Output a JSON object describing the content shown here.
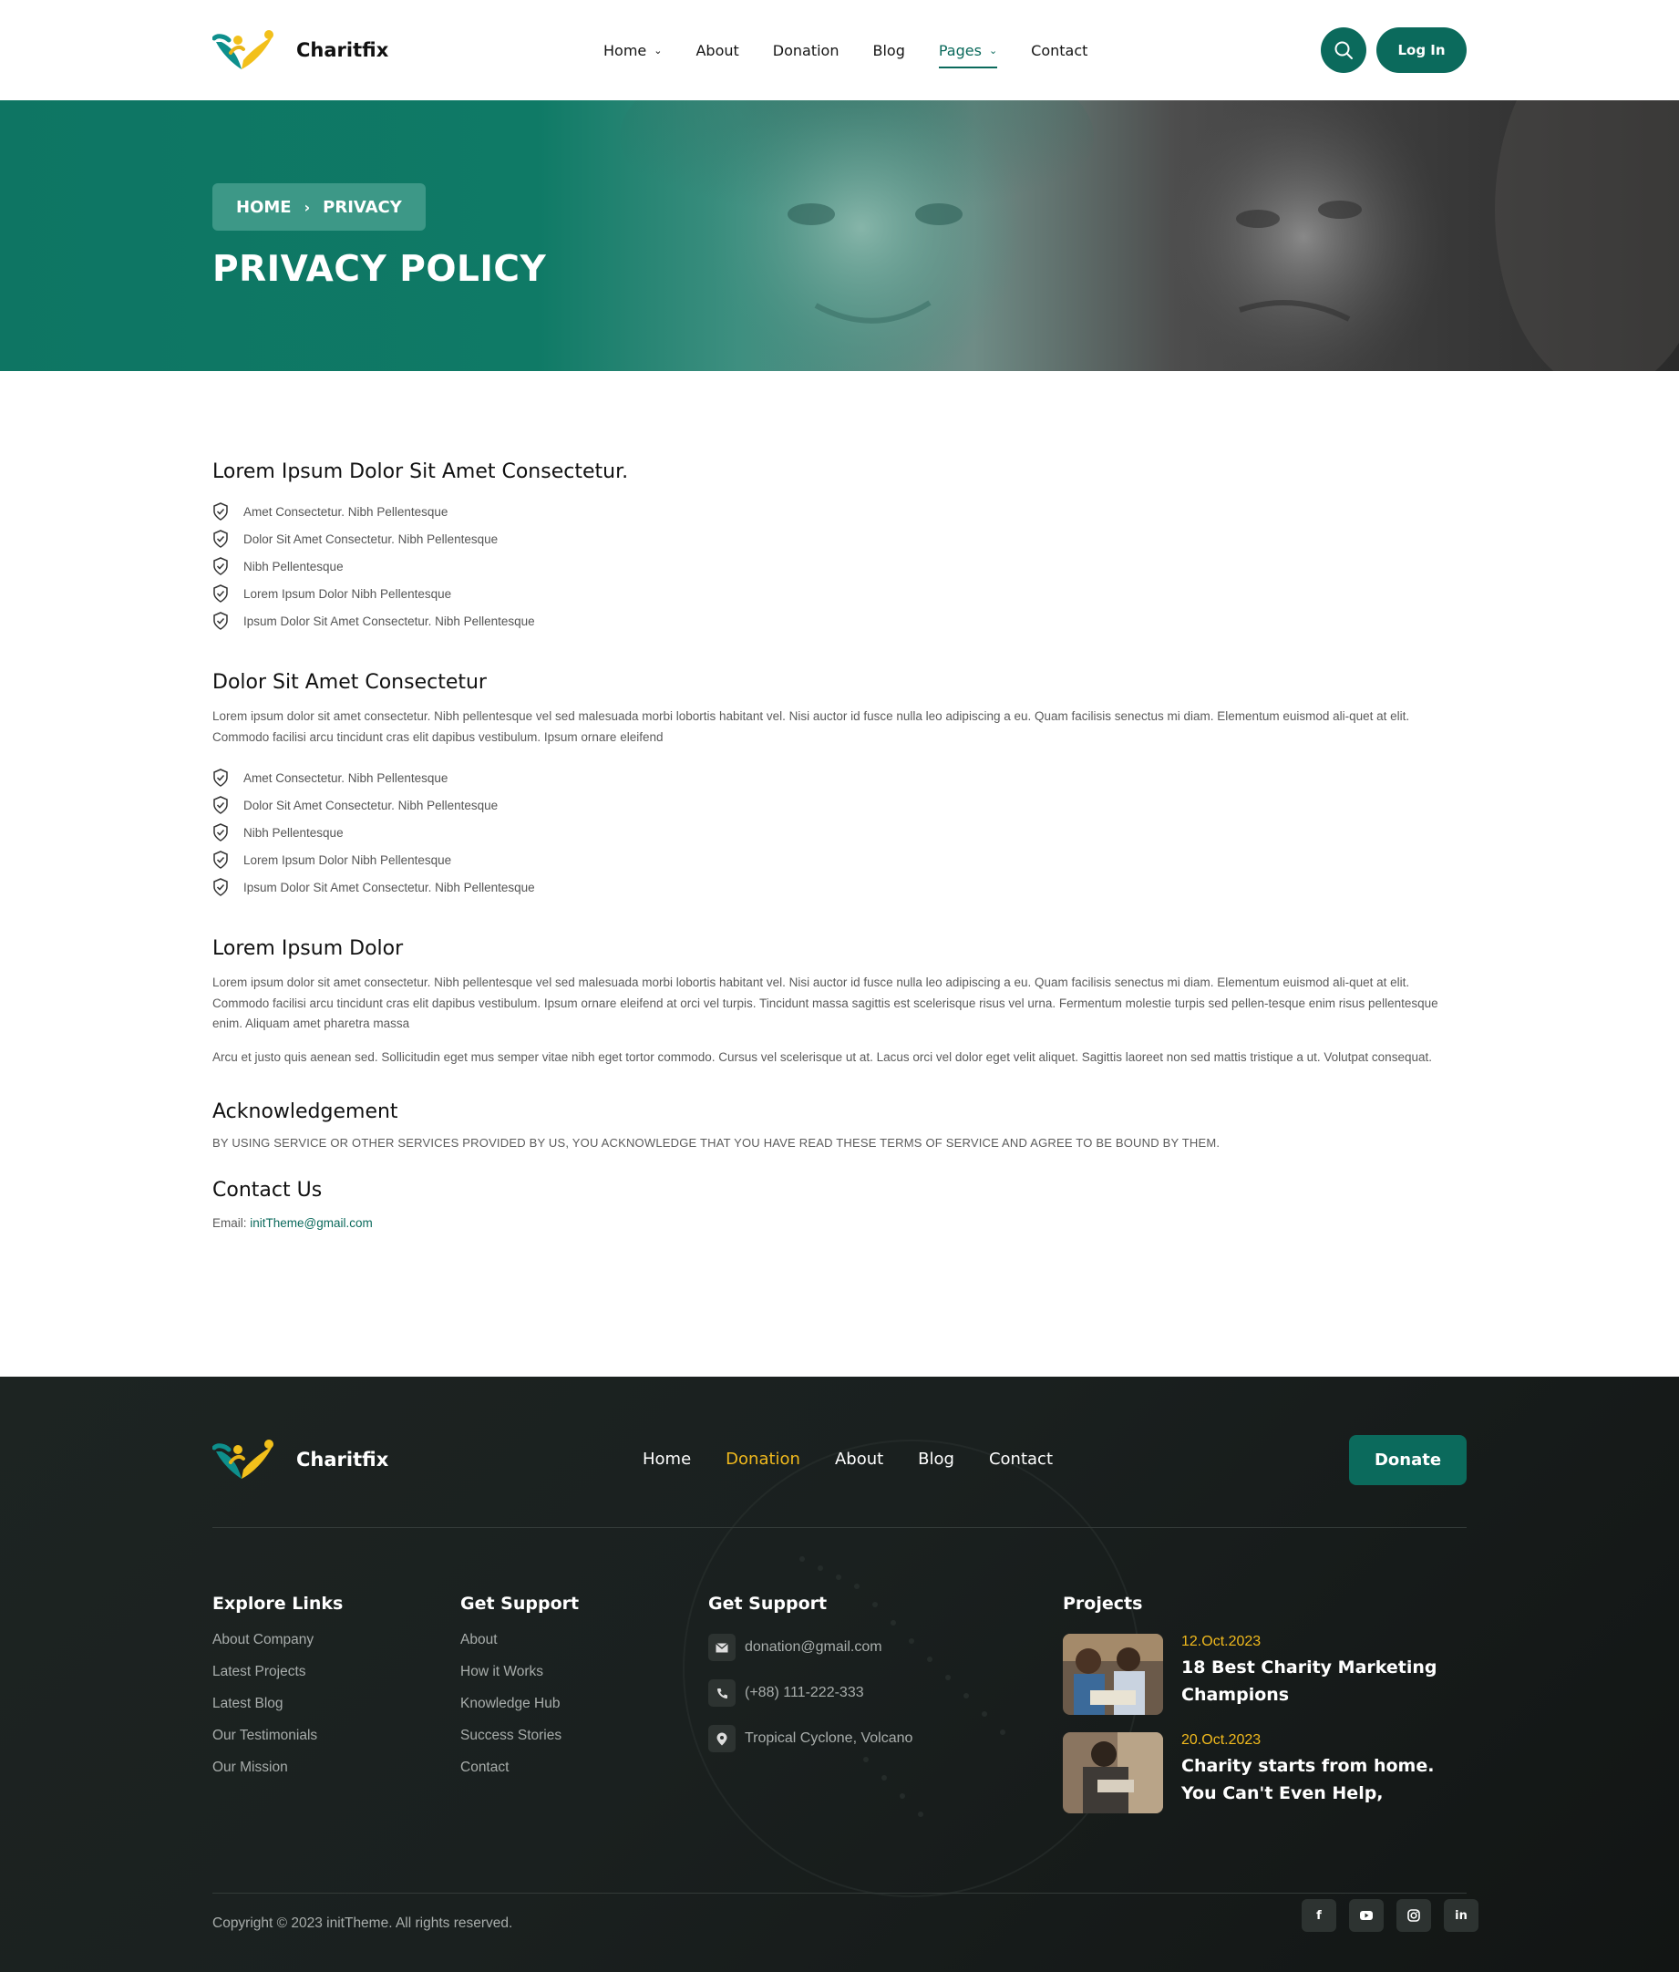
{
  "brand": {
    "name": "Charitfix"
  },
  "colors": {
    "primary": "#0b6a5c",
    "accent": "#f0b91d",
    "footer_bg": "#1a201f"
  },
  "header": {
    "nav": [
      {
        "label": "Home",
        "dropdown": true,
        "active": false
      },
      {
        "label": "About",
        "dropdown": false,
        "active": false
      },
      {
        "label": "Donation",
        "dropdown": false,
        "active": false
      },
      {
        "label": "Blog",
        "dropdown": false,
        "active": false
      },
      {
        "label": "Pages",
        "dropdown": true,
        "active": true
      },
      {
        "label": "Contact",
        "dropdown": false,
        "active": false
      }
    ],
    "search_icon": "search-icon",
    "login_label": "Log In"
  },
  "hero": {
    "breadcrumb": {
      "home": "HOME",
      "current": "PRIVACY"
    },
    "title": "PRIVACY POLICY"
  },
  "content": {
    "section1": {
      "heading": "Lorem Ipsum Dolor Sit Amet Consectetur.",
      "items": [
        "Amet Consectetur. Nibh Pellentesque",
        "Dolor Sit Amet Consectetur. Nibh Pellentesque",
        "Nibh Pellentesque",
        "Lorem Ipsum Dolor Nibh Pellentesque",
        "Ipsum Dolor Sit Amet Consectetur. Nibh Pellentesque"
      ]
    },
    "section2": {
      "heading": "Dolor Sit Amet Consectetur",
      "paragraph": "Lorem ipsum dolor sit amet consectetur. Nibh pellentesque vel sed malesuada morbi lobortis habitant vel. Nisi auctor id fusce nulla leo adipiscing a eu. Quam facilisis senectus mi diam. Elementum euismod ali-quet at elit. Commodo facilisi arcu tincidunt cras elit dapibus vestibulum. Ipsum ornare eleifend",
      "items": [
        "Amet Consectetur. Nibh Pellentesque",
        "Dolor Sit Amet Consectetur. Nibh Pellentesque",
        "Nibh Pellentesque",
        "Lorem Ipsum Dolor Nibh Pellentesque",
        "Ipsum Dolor Sit Amet Consectetur. Nibh Pellentesque"
      ]
    },
    "section3": {
      "heading": "Lorem Ipsum Dolor",
      "paragraph1": "Lorem ipsum dolor sit amet consectetur. Nibh pellentesque vel sed malesuada morbi lobortis habitant vel. Nisi auctor id fusce nulla leo adipiscing a eu. Quam facilisis senectus mi diam. Elementum euismod ali-quet at elit. Commodo facilisi arcu tincidunt cras elit dapibus vestibulum. Ipsum ornare eleifend at orci vel turpis. Tincidunt massa sagittis est scelerisque risus vel urna. Fermentum molestie turpis sed pellen-tesque enim risus pellentesque enim. Aliquam amet pharetra massa",
      "paragraph2": "Arcu et justo quis aenean sed. Sollicitudin eget mus semper vitae nibh eget tortor commodo. Cursus vel scelerisque ut at. Lacus orci vel dolor eget velit aliquet. Sagittis laoreet non sed mattis tristique a ut. Volutpat consequat."
    },
    "acknowledgement": {
      "heading": "Acknowledgement",
      "text": "BY USING SERVICE OR OTHER SERVICES PROVIDED BY US, YOU ACKNOWLEDGE THAT YOU HAVE READ THESE TERMS OF SERVICE AND AGREE TO BE BOUND BY THEM."
    },
    "contact": {
      "heading": "Contact Us",
      "email_label": "Email:",
      "email": "initTheme@gmail.com"
    }
  },
  "footer": {
    "nav": [
      {
        "label": "Home",
        "active": false
      },
      {
        "label": "Donation",
        "active": true
      },
      {
        "label": "About",
        "active": false
      },
      {
        "label": "Blog",
        "active": false
      },
      {
        "label": "Contact",
        "active": false
      }
    ],
    "donate_label": "Donate",
    "explore": {
      "title": "Explore Links",
      "links": [
        "About Company",
        "Latest Projects",
        "Latest Blog",
        "Our Testimonials",
        "Our Mission"
      ]
    },
    "support": {
      "title": "Get Support",
      "links": [
        "About",
        "How it Works",
        "Knowledge Hub",
        "Success Stories",
        "Contact"
      ]
    },
    "contact": {
      "title": "Get Support",
      "email": "donation@gmail.com",
      "phone": "(+88) 111-222-333",
      "address": "Tropical Cyclone, Volcano"
    },
    "projects": {
      "title": "Projects",
      "items": [
        {
          "date": "12.Oct.2023",
          "title": "18 Best Charity Marketing Champions"
        },
        {
          "date": "20.Oct.2023",
          "title": "Charity starts from home. You Can't Even Help,"
        }
      ]
    },
    "copyright": "Copyright © 2023 initTheme. All rights reserved.",
    "socials": [
      "facebook-icon",
      "youtube-icon",
      "instagram-icon",
      "linkedin-icon"
    ]
  }
}
